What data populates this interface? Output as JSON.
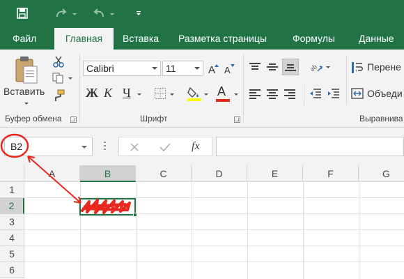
{
  "tabs": [
    "Файл",
    "Главная",
    "Вставка",
    "Разметка страницы",
    "Формулы",
    "Данные"
  ],
  "ribbon": {
    "paste_label": "Вставить",
    "clipboard_group": "Буфер обмена",
    "font_group": "Шрифт",
    "alignment_group": "Выравнива",
    "font_name": "Calibri",
    "font_size": "11",
    "bold": "Ж",
    "italic": "К",
    "underline": "Ч",
    "font_color_letter": "А",
    "wrap_text": "Перене",
    "merge_cells": "Объеди"
  },
  "formula_bar": {
    "name_box": "B2",
    "fx": "fx"
  },
  "grid": {
    "columns": [
      "A",
      "B",
      "C",
      "D",
      "E",
      "F",
      "G"
    ],
    "rows": [
      "1",
      "2",
      "3",
      "4",
      "5",
      "6"
    ],
    "selected_column": "B",
    "selected_row": "2"
  },
  "colors": {
    "excel_green": "#217346",
    "annotation_red": "#e8281e",
    "highlight_yellow": "#ffff00",
    "font_red": "#e8281e"
  },
  "icons": [
    "save-icon",
    "redo-icon",
    "undo-icon",
    "customize-qat-icon",
    "paste-icon",
    "cut-icon",
    "copy-icon",
    "format-painter-icon",
    "increase-font-icon",
    "decrease-font-icon",
    "borders-icon",
    "fill-color-icon",
    "font-color-icon",
    "align-top-icon",
    "align-middle-icon",
    "align-bottom-icon",
    "orientation-icon",
    "align-left-icon",
    "align-center-icon",
    "align-right-icon",
    "decrease-indent-icon",
    "increase-indent-icon",
    "wrap-text-icon",
    "merge-icon",
    "cancel-icon",
    "enter-icon"
  ]
}
